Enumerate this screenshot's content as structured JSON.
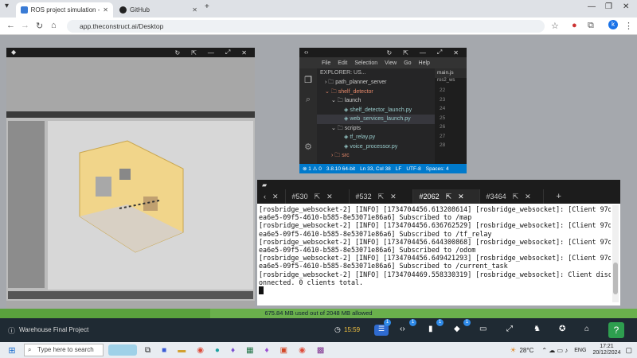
{
  "browser": {
    "tabs": [
      {
        "title": "ROS project simulation - Ware",
        "active": true
      },
      {
        "title": "GitHub",
        "active": false
      }
    ],
    "new_tab": "+",
    "url": "app.theconstruct.ai/Desktop",
    "profile_initial": "k"
  },
  "vscode": {
    "menu": [
      "File",
      "Edit",
      "Selection",
      "View",
      "Go",
      "Help"
    ],
    "explorer_title": "EXPLORER: US...",
    "open_file_tab": "main.js",
    "tree": [
      {
        "label": "path_planner_server",
        "level": 0
      },
      {
        "label": "shelf_detector",
        "level": 0,
        "highlight": true
      },
      {
        "label": "launch",
        "level": 1
      },
      {
        "label": "shelf_detector_launch.py",
        "level": 2
      },
      {
        "label": "web_services_launch.py",
        "level": 2,
        "selected": true
      },
      {
        "label": "scripts",
        "level": 1
      },
      {
        "label": "tf_relay.py",
        "level": 2
      },
      {
        "label": "voice_processor.py",
        "level": 2
      },
      {
        "label": "src",
        "level": 1
      }
    ],
    "editor_crumb": "ros2_ws",
    "line_numbers": [
      "22",
      "23",
      "24",
      "25",
      "26",
      "27",
      "28"
    ],
    "status": [
      "⊗ 1 ⚠ 0",
      "3.8.10 64-bit",
      "Ln 33, Col 38",
      "LF",
      "UTF-8",
      "Spaces: 4"
    ]
  },
  "terminal": {
    "tabs": [
      {
        "label": "#530",
        "active": false
      },
      {
        "label": "#532",
        "active": false
      },
      {
        "label": "#2062",
        "active": true
      },
      {
        "label": "#3464",
        "active": false
      }
    ],
    "lines": [
      "[rosbridge_websocket-2] [INFO] [1734704456.613208614] [rosbridge_websocket]: [Client 97d",
      "ea6e5-09f5-4610-b585-8e53071e86a6] Subscribed to /map",
      "[rosbridge_websocket-2] [INFO] [1734704456.636762529] [rosbridge_websocket]: [Client 97d",
      "ea6e5-09f5-4610-b585-8e53071e86a6] Subscribed to /tf_relay",
      "[rosbridge_websocket-2] [INFO] [1734704456.644300868] [rosbridge_websocket]: [Client 97d",
      "ea6e5-09f5-4610-b585-8e53071e86a6] Subscribed to /odom",
      "[rosbridge_websocket-2] [INFO] [1734704456.649421293] [rosbridge_websocket]: [Client 97d",
      "ea6e5-09f5-4610-b585-8e53071e86a6] Subscribed to /current_task",
      "[rosbridge_websocket-2] [INFO] [1734704469.558330319] [rosbridge_websocket]: Client disc",
      "onnected. 0 clients total."
    ]
  },
  "memory": {
    "text": "675.84 MB used out of 2048 MB allowed",
    "used_fraction": 0.33
  },
  "appbar": {
    "project": "Warehouse Final Project",
    "timer": "15:59",
    "badges": [
      "1",
      "1",
      "1",
      "1"
    ]
  },
  "taskbar": {
    "search_placeholder": "Type here to search",
    "weather": "28°C",
    "language": "ENG",
    "time": "17:21",
    "date": "20/12/2024"
  }
}
